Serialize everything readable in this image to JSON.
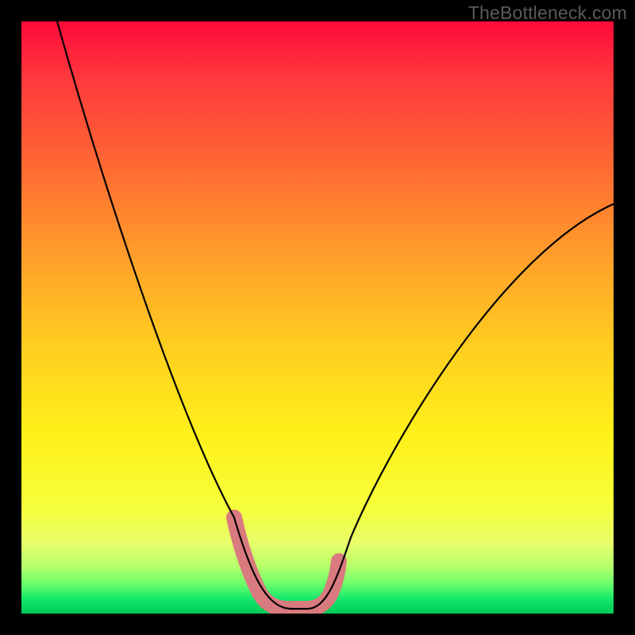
{
  "watermark": "TheBottleneck.com",
  "colors": {
    "frame": "#000000",
    "curve": "#000000",
    "highlight": "#d97a7f",
    "gradient_top": "#ff0a3a",
    "gradient_mid": "#fff11a",
    "gradient_bottom": "#00c957"
  },
  "chart_data": {
    "type": "line",
    "title": "",
    "xlabel": "",
    "ylabel": "",
    "xlim": [
      0,
      100
    ],
    "ylim": [
      0,
      100
    ],
    "series": [
      {
        "name": "bottleneck-curve",
        "x": [
          6,
          10,
          15,
          20,
          25,
          30,
          33,
          36,
          38,
          40,
          42,
          44,
          47,
          50,
          55,
          60,
          65,
          70,
          75,
          80,
          85,
          90,
          95,
          100
        ],
        "values": [
          100,
          87,
          72,
          58,
          45,
          32,
          24,
          16,
          10,
          5,
          2,
          1,
          1,
          1,
          3,
          8,
          14,
          21,
          29,
          37,
          45,
          53,
          61,
          69
        ]
      }
    ],
    "annotations": [
      {
        "name": "optimal-band",
        "x_range": [
          36,
          52
        ],
        "y_range": [
          0,
          16
        ],
        "note": "pink highlighted U-bottom segment"
      }
    ]
  }
}
